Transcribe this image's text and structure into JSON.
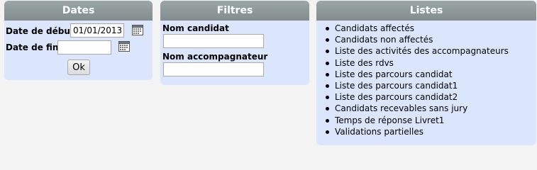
{
  "dates": {
    "title": "Dates",
    "start_label": "Date de début",
    "start_value": "01/01/2013",
    "end_label": "Date de fin",
    "end_value": "",
    "ok_label": "Ok"
  },
  "filtres": {
    "title": "Filtres",
    "candidate_label": "Nom candidat",
    "candidate_value": "",
    "companion_label": "Nom accompagnateur",
    "companion_value": ""
  },
  "listes": {
    "title": "Listes",
    "items": [
      "Candidats affectés",
      "Candidats non affectés",
      "Liste des activités des accompagnateurs",
      "Liste des rdvs",
      "Liste des parcours candidat",
      "Liste des parcours candidat1",
      "Liste des parcours candidat2",
      "Candidats recevables sans jury",
      "Temps de réponse Livret1",
      "Validations partielles"
    ]
  },
  "icons": {
    "calendar": "calendar-icon"
  },
  "colors": {
    "panel_bg": "#dbe5fb",
    "header_bg": "#8f999a",
    "page_bg": "#f3f3f3"
  }
}
